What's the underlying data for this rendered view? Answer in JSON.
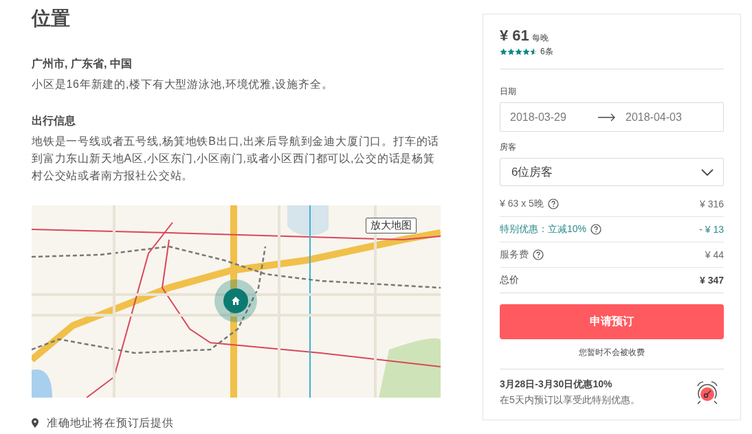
{
  "location": {
    "title": "位置",
    "place": "广州市, 广东省, 中国",
    "place_note": "小区是16年新建的,楼下有大型游泳池,环境优雅,设施齐全。",
    "transport_heading": "出行信息",
    "transport_text": "地铁是一号线或者五号线,杨箕地铁B出口,出来后导航到金迪大厦门口。打车的话到富力东山新天地A区,小区东门,小区南门,或者小区西门都可以,公交的话是杨箕村公交站或者南方报社公交站。",
    "map": {
      "zoom_button": "放大地图"
    },
    "address_note": "准确地址将在预订后提供"
  },
  "booking": {
    "price": "¥ 61",
    "per_night": "每晚",
    "stars": 4.5,
    "review_count": "6条",
    "date_label": "日期",
    "check_in": "2018-03-29",
    "check_out": "2018-04-03",
    "guests_label": "房客",
    "guests": "6位房客",
    "fees": [
      {
        "kind": "base",
        "label": "¥ 63 x 5晚",
        "amount": "¥ 316",
        "help": true
      },
      {
        "kind": "discount",
        "label": "特别优惠：立减10%",
        "amount": "- ¥ 13",
        "help": true
      },
      {
        "kind": "base",
        "label": "服务费",
        "amount": "¥ 44",
        "help": true
      },
      {
        "kind": "total",
        "label": "总价",
        "amount": "¥ 347",
        "help": false
      }
    ],
    "book_button": "申请预订",
    "charge_note": "您暂时不会被收费",
    "promo_title": "3月28日-3月30日优惠10%",
    "promo_text": "在5天内预订以享受此特别优惠。"
  }
}
